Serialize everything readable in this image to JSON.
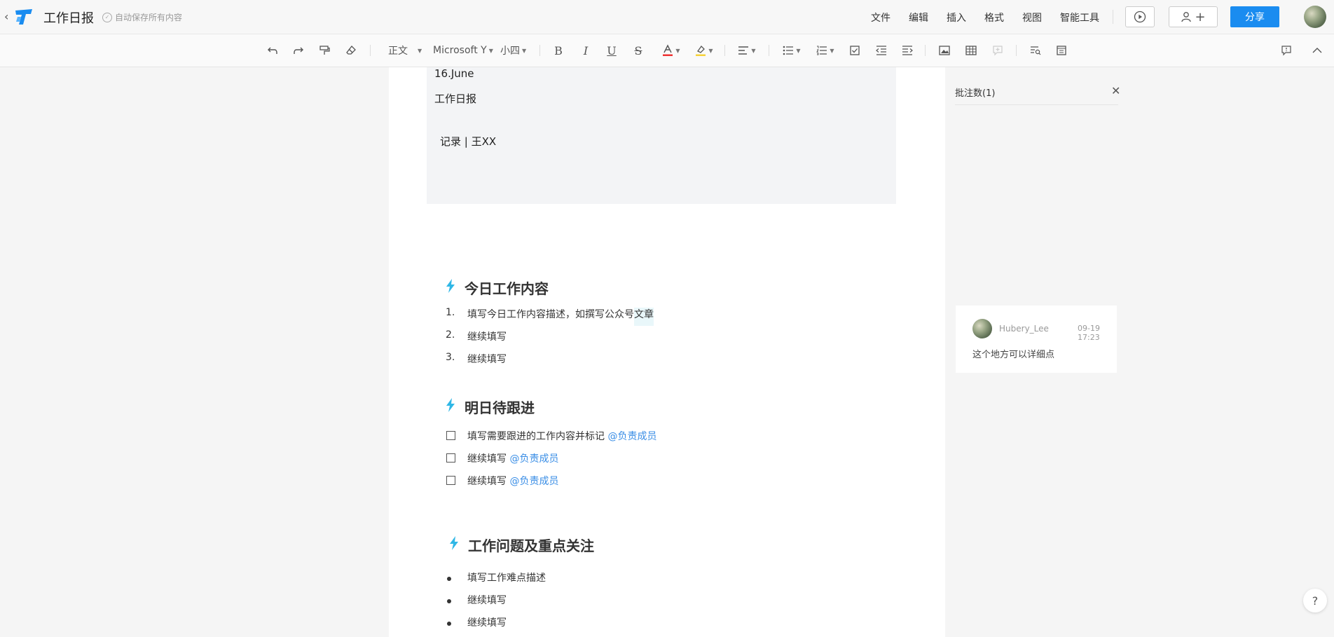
{
  "header": {
    "title": "工作日报",
    "autosave": "自动保存所有内容",
    "menus": [
      "文件",
      "编辑",
      "插入",
      "格式",
      "视图",
      "智能工具"
    ],
    "share_label": "分享"
  },
  "toolbar": {
    "style_value": "正文",
    "font_value": "Microsoft Y",
    "size_value": "小四"
  },
  "doc": {
    "date": "16.June",
    "header_title": "工作日报",
    "record": "记录 | 王XX",
    "sections": [
      {
        "title": "今日工作内容",
        "items": [
          {
            "marker": "1.",
            "text": "填写今日工作内容描述，如撰写公众号",
            "highlight": "文章"
          },
          {
            "marker": "2.",
            "text": "继续填写"
          },
          {
            "marker": "3.",
            "text": "继续填写"
          }
        ]
      },
      {
        "title": "明日待跟进",
        "items": [
          {
            "text": "填写需要跟进的工作内容并标记",
            "mention": "@负责成员"
          },
          {
            "text": "继续填写",
            "mention": "@负责成员"
          },
          {
            "text": "继续填写",
            "mention": "@负责成员"
          }
        ]
      },
      {
        "title": "工作问题及重点关注",
        "items": [
          {
            "text": "填写工作难点描述"
          },
          {
            "text": "继续填写"
          },
          {
            "text": "继续填写"
          }
        ]
      }
    ]
  },
  "comments": {
    "title": "批注数(1)",
    "items": [
      {
        "user": "Hubery_Lee",
        "time": "09-19 17:23",
        "text": "这个地方可以详细点"
      }
    ]
  },
  "help_label": "?",
  "colors": {
    "accent": "#1a8cf0",
    "mention": "#3a8ee6",
    "section_icon": "#2fb7e6",
    "header_box": "#f3f4f6"
  }
}
